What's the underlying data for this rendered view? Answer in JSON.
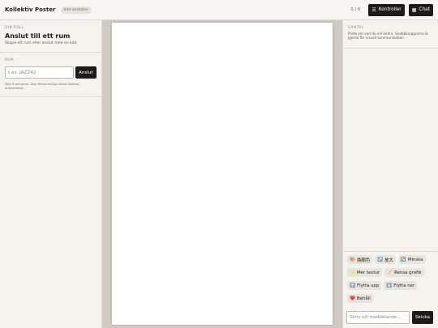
{
  "header": {
    "title": "Kollektiv Poster",
    "status": "Inte ansluten",
    "count": "0 / 6",
    "controls_label": "Kontroller",
    "chat_label": "Chat"
  },
  "role_section": {
    "label": "DIN ROLL",
    "title": "Anslut till ett rum",
    "subtitle": "Skapa ett rum eller anslut med en kod."
  },
  "room_section": {
    "label": "RUM",
    "placeholder": "t.ex. JAZZ42",
    "join_label": "Anslut",
    "note": "Max 6 personer. Den första lediga rollen tilldelas automatiskt."
  },
  "chat": {
    "label": "SAMTAL",
    "description": "Prata om vad du vill ändra. Snabbknapparna är gjorda för visuell kommunikation.",
    "quick_actions": [
      {
        "icon": "🎨",
        "label": "換顏色"
      },
      {
        "icon": "↗️",
        "label": "放大"
      },
      {
        "icon": "↘️",
        "label": "Minska"
      },
      {
        "icon": "✨",
        "label": "Mer textur"
      },
      {
        "icon": "🧹",
        "label": "Rensa grafik"
      },
      {
        "icon": "⬆️",
        "label": "Flytta upp"
      },
      {
        "icon": "⬇️",
        "label": "Flytta ner"
      },
      {
        "icon": "❤️",
        "label": "Behåll"
      }
    ],
    "message_placeholder": "Skriv ett meddelande...",
    "send_label": "Skicka"
  }
}
